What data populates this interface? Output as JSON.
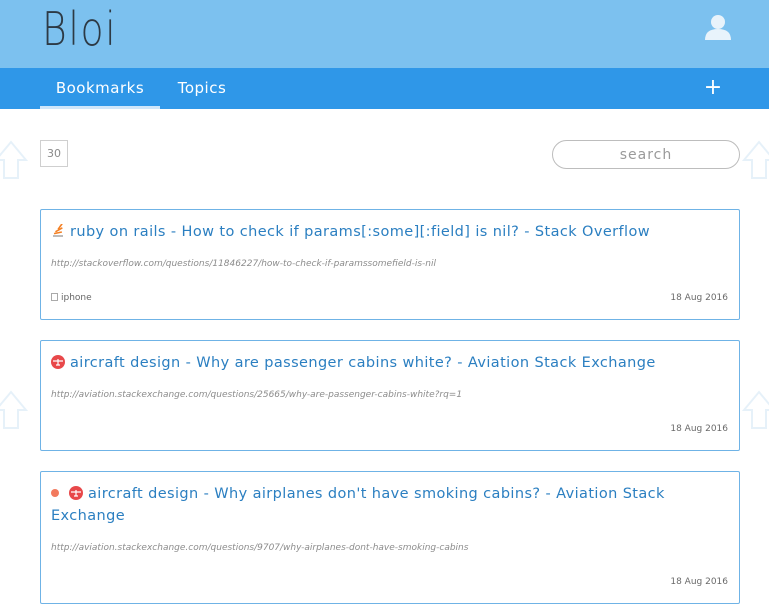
{
  "app": {
    "title": "Bloi"
  },
  "nav": {
    "tabs": [
      {
        "label": "Bookmarks",
        "active": true
      },
      {
        "label": "Topics",
        "active": false
      }
    ],
    "add_label": "+"
  },
  "toolbar": {
    "count": "30",
    "search_placeholder": "search"
  },
  "bookmarks": [
    {
      "title": "ruby on rails - How to check if params[:some][:field] is nil? - Stack Overflow",
      "url": "http://stackoverflow.com/questions/11846227/how-to-check-if-paramssomefield-is-nil",
      "tag": "iphone",
      "date": "18 Aug 2016",
      "favicon": "stackoverflow-icon",
      "unread": false
    },
    {
      "title": "aircraft design - Why are passenger cabins white? - Aviation Stack Exchange",
      "url": "http://aviation.stackexchange.com/questions/25665/why-are-passenger-cabins-white?rq=1",
      "tag": "",
      "date": "18 Aug 2016",
      "favicon": "aviation-icon",
      "unread": false
    },
    {
      "title": "aircraft design - Why airplanes don't have smoking cabins? - Aviation Stack Exchange",
      "url": "http://aviation.stackexchange.com/questions/9707/why-airplanes-dont-have-smoking-cabins",
      "tag": "",
      "date": "18 Aug 2016",
      "favicon": "aviation-icon",
      "unread": true
    }
  ],
  "colors": {
    "header": "#7cc1ef",
    "navbar": "#2f97e8",
    "link": "#2b7fc1",
    "card_border": "#6fb3e6",
    "unread_dot": "#f27a5e"
  }
}
